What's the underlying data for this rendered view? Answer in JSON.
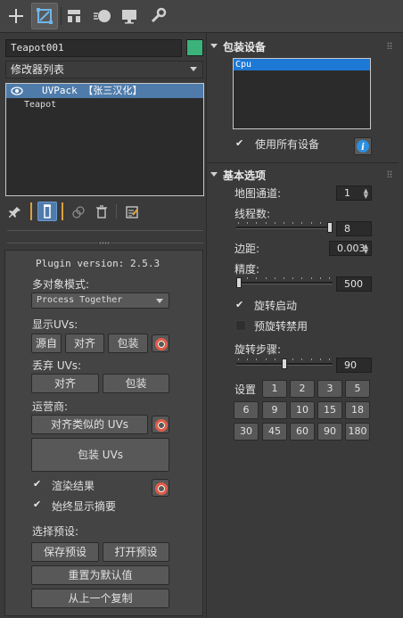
{
  "toolbar": {
    "icons": [
      "plus-icon",
      "modify-icon",
      "hierarchy-icon",
      "motion-icon",
      "display-icon",
      "utilities-icon"
    ]
  },
  "object": {
    "name": "Teapot001",
    "color": "#3bb27a"
  },
  "modifier_list": {
    "label": "修改器列表"
  },
  "stack": {
    "items": [
      "UVPack 【张三汉化】",
      "Teapot"
    ]
  },
  "plugin": {
    "version": "Plugin version: 2.5.3",
    "multi_object_label": "多对象模式:",
    "multi_object_value": "Process Together",
    "show_uvs_label": "显示UVs:",
    "show_uvs_buttons": [
      "源自",
      "对齐",
      "包装"
    ],
    "discard_uvs_label": "丢弃 UVs:",
    "discard_buttons": [
      "对齐",
      "包装"
    ],
    "operator_label": "运营商:",
    "align_similar": "对齐类似的 UVs",
    "pack_uvs": "包装 UVs",
    "render_result": "渲染结果",
    "always_show_summary": "始终显示摘要",
    "presets_label": "选择预设:",
    "save_preset": "保存预设",
    "open_preset": "打开预设",
    "reset_default": "重置为默认值",
    "copy_previous": "从上一个复制"
  },
  "devices": {
    "title": "包装设备",
    "list": [
      "Cpu"
    ],
    "use_all_label": "使用所有设备",
    "use_all_checked": true
  },
  "basic": {
    "title": "基本选项",
    "map_channel_label": "地图通道:",
    "map_channel_value": "1",
    "threads_label": "线程数:",
    "threads_value": "8",
    "threads_fraction": 1.0,
    "margin_label": "边距:",
    "margin_value": "0.003",
    "precision_label": "精度:",
    "precision_value": "500",
    "precision_fraction": 0.0,
    "rotate_enable_label": "旋转启动",
    "rotate_enable_checked": true,
    "prerotate_label": "预旋转禁用",
    "prerotate_checked": false,
    "rotate_step_label": "旋转步骤:",
    "rotate_step_value": "90",
    "rotate_step_fraction": 0.5,
    "settings_label": "设置",
    "settings_buttons": [
      "1",
      "2",
      "3",
      "5",
      "6",
      "9",
      "10",
      "15",
      "18",
      "30",
      "45",
      "60",
      "90",
      "180"
    ]
  }
}
